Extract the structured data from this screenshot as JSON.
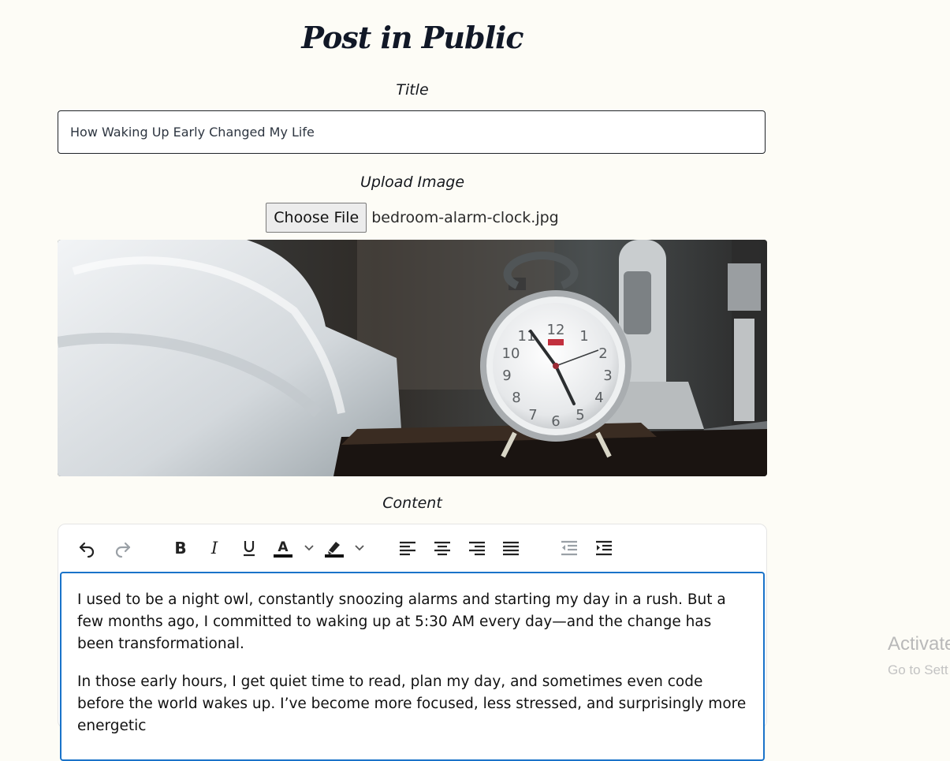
{
  "header": {
    "title": "Post in Public"
  },
  "form": {
    "title_label": "Title",
    "title_value": "How Waking Up Early Changed My Life",
    "upload_label": "Upload Image",
    "choose_file_label": "Choose File",
    "file_name": "bedroom-alarm-clock.jpg",
    "content_label": "Content"
  },
  "toolbar": {
    "buttons": [
      "undo-icon",
      "redo-icon",
      "bold-icon",
      "italic-icon",
      "underline-icon",
      "text-color-icon",
      "highlight-icon",
      "align-left-icon",
      "align-center-icon",
      "align-right-icon",
      "align-justify-icon",
      "outdent-icon",
      "indent-icon"
    ],
    "text_color_swatch": "#111111",
    "highlight_swatch": "#111111"
  },
  "content": {
    "paragraphs": [
      "I used to be a night owl, constantly snoozing alarms and starting my day in a rush. But a few months ago, I committed to waking up at 5:30 AM every day—and the change has been transformational.",
      "In those early hours, I get quiet time to read, plan my day, and sometimes even code before the world wakes up. I’ve become more focused, less stressed, and surprisingly more energetic"
    ]
  },
  "watermark": {
    "title": "Activate",
    "subtitle": "Go to Sett"
  },
  "colors": {
    "background": "#fdfcf6",
    "editor_focus": "#1a73c9",
    "text": "#111111"
  }
}
